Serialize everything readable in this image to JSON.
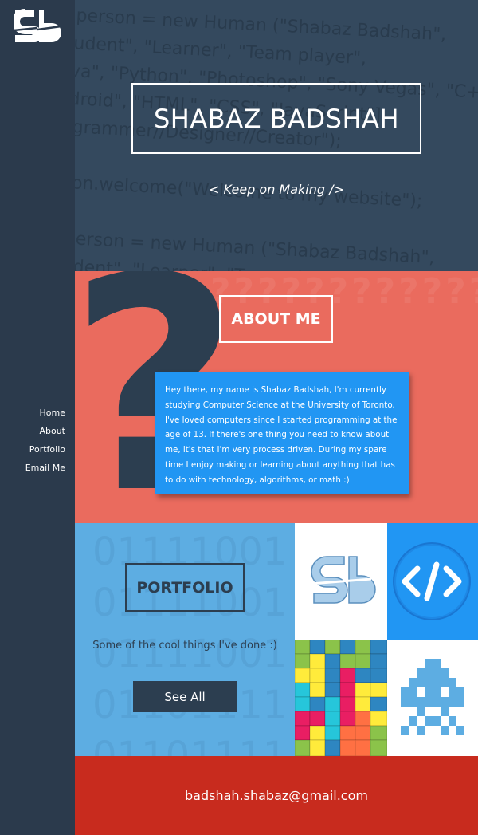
{
  "sidebar": {
    "logo_text": "sb",
    "nav": [
      {
        "label": "Home"
      },
      {
        "label": "About"
      },
      {
        "label": "Portfolio"
      },
      {
        "label": "Email Me"
      }
    ]
  },
  "hero": {
    "title": "SHABAZ BADSHAH",
    "tagline": "< Keep on Making />",
    "code_lines": [
      "var person = new Human (\"Shabaz Badshah\",",
      "[\"Student\", \"Learner\", \"Team player\",",
      "[\"Java\", \"Python\", \"Photoshop\", \"Sony Vegas\", \"C++\", \"C\",",
      "\"Android\", \"HTML\", \"CSS\", \"JavaScript\"],",
      "\"Programmer//Designer//Creator\");",
      "",
      "person.welcome(\"Welcome to my website\");",
      "",
      "var person = new Human (\"Shabaz Badshah\",",
      "[\"Student\", \"Learner\", \"Team player\","
    ]
  },
  "about": {
    "title": "ABOUT ME",
    "text": "Hey there, my name is Shabaz Badshah, I'm currently studying Computer Science at the University of Toronto. I've loved computers since I started programming at the age of 13. If there's one thing you need to know about me, it's that I'm very process driven. During my spare time I enjoy making or learning about anything that has to do with technology, algorithms, or math :)",
    "big_glyph": "?"
  },
  "portfolio": {
    "title": "PORTFOLIO",
    "subtitle": "Some of the cool things I've done :)",
    "button": "See All",
    "binary_lines": [
      "01111001",
      "01111001",
      "01111001",
      "01101111",
      "01101111"
    ],
    "tiles": [
      {
        "icon": "sb-logo-icon"
      },
      {
        "icon": "code-icon",
        "label": "</>"
      },
      {
        "icon": "tetris-icon"
      },
      {
        "icon": "space-invader-icon"
      }
    ]
  },
  "footer": {
    "email": "badshah.shabaz@gmail.com"
  },
  "colors": {
    "sidebar": "#2b3a4c",
    "hero": "#34495e",
    "about": "#ea6b5e",
    "about_card": "#2196f3",
    "portfolio": "#5dade2",
    "footer": "#c82b1e"
  }
}
